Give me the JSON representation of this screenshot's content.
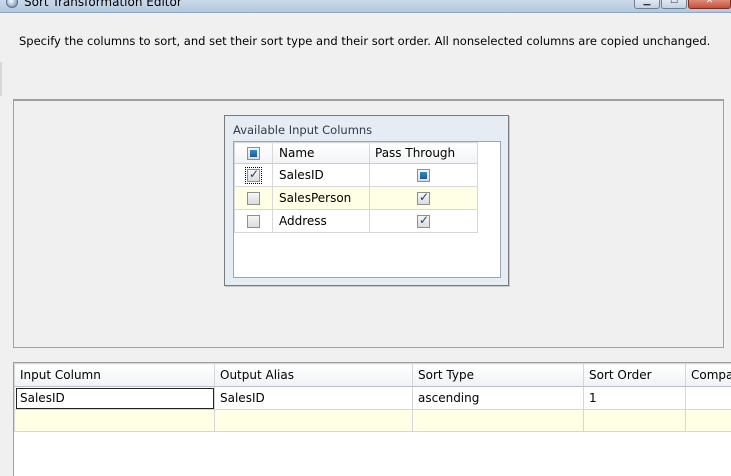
{
  "window": {
    "title": "Sort Transformation Editor",
    "min_glyph": "▁",
    "max_glyph": "☐",
    "close_glyph": "✕"
  },
  "description": "Specify the columns to sort, and set their sort type and their sort order. All nonselected columns are copied unchanged.",
  "available_columns": {
    "title": "Available Input Columns",
    "headers": {
      "name": "Name",
      "pass_through": "Pass Through"
    },
    "rows": [
      {
        "name": "SalesID",
        "selected": true,
        "pass_through": "indeterminate"
      },
      {
        "name": "SalesPerson",
        "selected": false,
        "pass_through": "checked"
      },
      {
        "name": "Address",
        "selected": false,
        "pass_through": "checked"
      }
    ]
  },
  "sort_grid": {
    "headers": [
      "Input Column",
      "Output Alias",
      "Sort Type",
      "Sort Order",
      "Comparison Flags"
    ],
    "rows": [
      {
        "input_column": "SalesID",
        "output_alias": "SalesID",
        "sort_type": "ascending",
        "sort_order": "1",
        "comparison_flags": ""
      }
    ]
  },
  "colors": {
    "highlight_row": "#ffffe6",
    "panel_bg": "#f0f0f0",
    "box_bg": "#e6ecf3"
  }
}
